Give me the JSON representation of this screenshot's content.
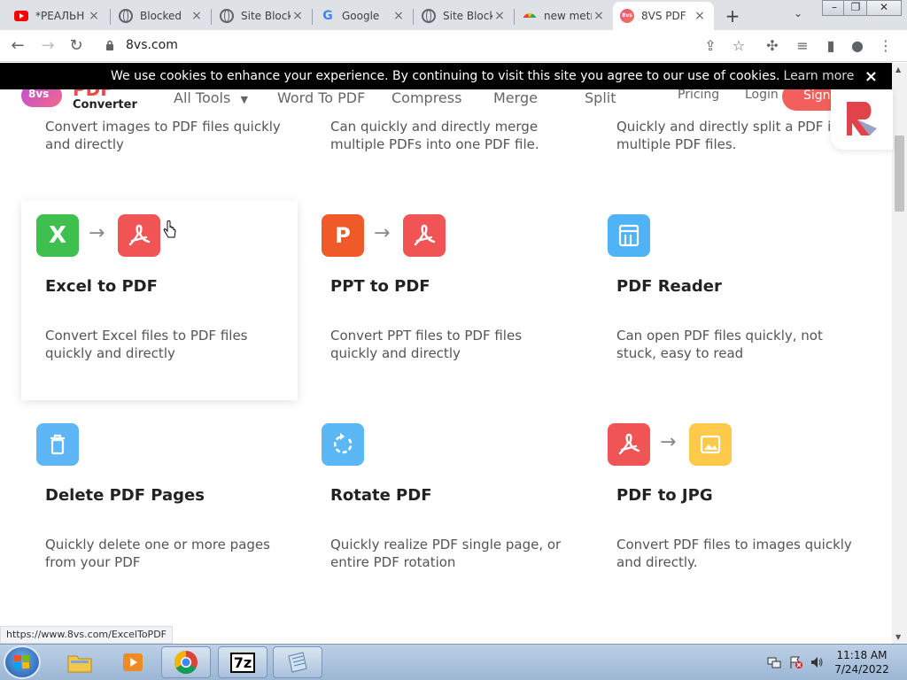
{
  "tabs": [
    {
      "title": "*РЕАЛЬН",
      "icon": "youtube-icon"
    },
    {
      "title": "Blocked",
      "icon": "globe-icon"
    },
    {
      "title": "Site Block",
      "icon": "globe-icon"
    },
    {
      "title": "Google",
      "icon": "google-icon"
    },
    {
      "title": "Site Block",
      "icon": "globe-icon"
    },
    {
      "title": "new metr",
      "icon": "rainbow-icon"
    },
    {
      "title": "8VS PDF",
      "icon": "8vs-icon"
    }
  ],
  "tab_close_glyph": "×",
  "new_tab_glyph": "+",
  "address_bar": {
    "url": "8vs.com"
  },
  "cookie_bar": {
    "text": "We use cookies to enhance your experience. By continuing to visit this site you agree to our use of cookies.",
    "link": "Learn more",
    "close": "×"
  },
  "site_header": {
    "logo_badge": "8vs",
    "logo_pdf": "PDF",
    "logo_converter": "Converter",
    "nav": [
      "All Tools",
      "Word To PDF",
      "Compress",
      "Merge",
      "Split"
    ],
    "pricing": "Pricing",
    "login": "Login",
    "signup": "Sign"
  },
  "top_partial_cards": [
    {
      "desc": "Convert images to PDF files quickly and directly"
    },
    {
      "desc": "Can quickly and directly merge multiple PDFs into one PDF file."
    },
    {
      "desc": "Quickly and directly split a PDF into multiple PDF files."
    }
  ],
  "cards": [
    {
      "title": "Excel to PDF",
      "desc": "Convert Excel files to PDF files quickly and directly"
    },
    {
      "title": "PPT to PDF",
      "desc": "Convert PPT files to PDF files quickly and directly"
    },
    {
      "title": "PDF Reader",
      "desc": "Can open PDF files quickly, not stuck, easy to read"
    },
    {
      "title": "Delete PDF Pages",
      "desc": "Quickly delete one or more pages from your PDF"
    },
    {
      "title": "Rotate PDF",
      "desc": "Quickly realize PDF single page, or entire PDF rotation"
    },
    {
      "title": "PDF to JPG",
      "desc": "Convert PDF files to images quickly and directly."
    }
  ],
  "icon_glyphs": {
    "excel": "X",
    "ppt": "P",
    "arrow": "→"
  },
  "status_url": "https://www.8vs.com/ExcelToPDF",
  "taskbar": {
    "time": "11:18 AM",
    "date": "7/24/2022",
    "sevenzip": "7z"
  },
  "colors": {
    "accent_red": "#f25f5c",
    "excel_green": "#3fbf4d",
    "ppt_orange": "#f05a28",
    "pdf_red": "#f05454",
    "info_blue": "#4fb3f6",
    "jpg_yellow": "#ffc94a"
  }
}
